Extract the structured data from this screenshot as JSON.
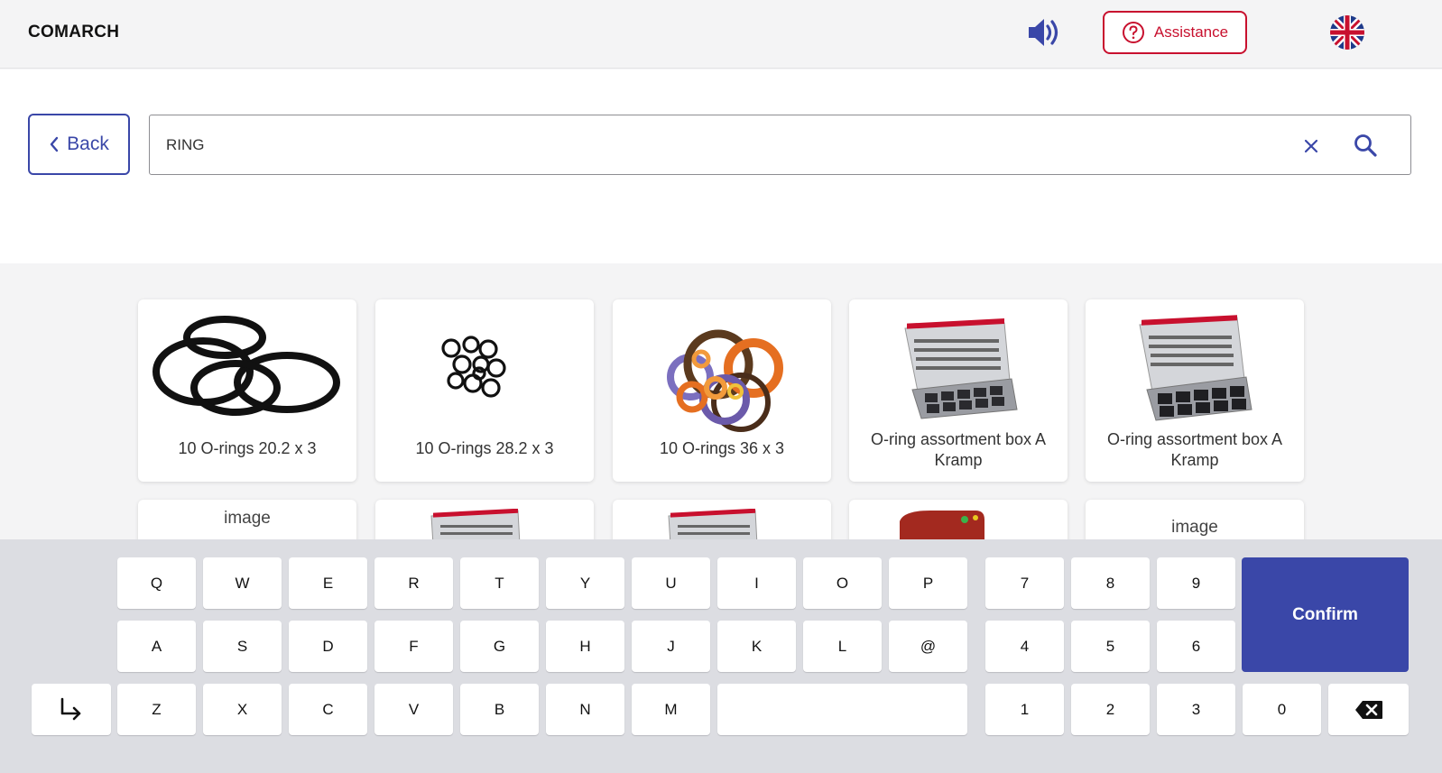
{
  "header": {
    "logo": "COMARCH",
    "assistance_label": "Assistance",
    "icons": {
      "speaker": "speaker-icon",
      "help": "help-circle-icon",
      "language": "uk-flag-icon"
    }
  },
  "search": {
    "back_label": "Back",
    "query": "RING"
  },
  "results": [
    {
      "title": "10 O-rings 20.2 x 3"
    },
    {
      "title": "10 O-rings 28.2 x 3"
    },
    {
      "title": "10 O-rings 36 x 3"
    },
    {
      "title": "O-ring assortment box A Kramp"
    },
    {
      "title": "O-ring assortment box A Kramp"
    }
  ],
  "results_row2": [
    {
      "alt": "image"
    },
    {
      "alt": ""
    },
    {
      "alt": ""
    },
    {
      "alt": ""
    },
    {
      "alt": "image"
    }
  ],
  "keyboard": {
    "row1": [
      "Q",
      "W",
      "E",
      "R",
      "T",
      "Y",
      "U",
      "I",
      "O",
      "P"
    ],
    "row2": [
      "A",
      "S",
      "D",
      "F",
      "G",
      "H",
      "J",
      "K",
      "L",
      "@"
    ],
    "row3": [
      "Z",
      "X",
      "C",
      "V",
      "B",
      "N",
      "M"
    ],
    "num1": [
      "7",
      "8",
      "9"
    ],
    "num2": [
      "4",
      "5",
      "6"
    ],
    "num3": [
      "1",
      "2",
      "3",
      "0"
    ],
    "confirm_label": "Confirm"
  },
  "colors": {
    "brand": "#3a47a8",
    "assist": "#c8102e"
  }
}
